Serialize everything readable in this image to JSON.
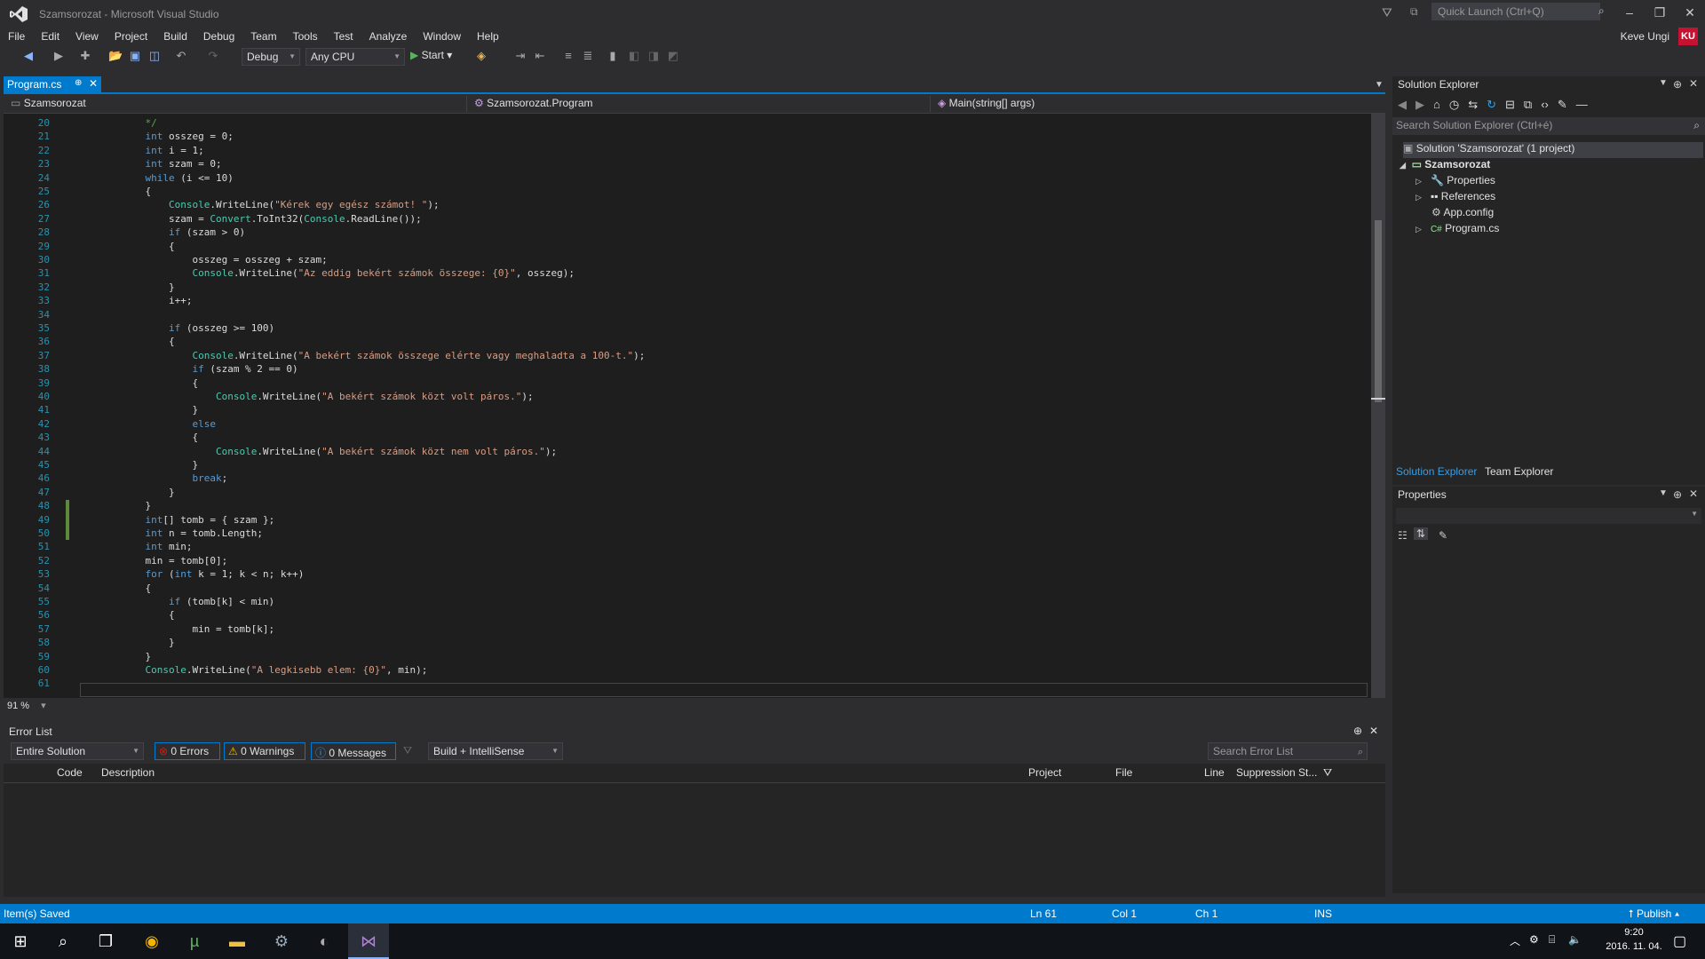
{
  "window": {
    "title": "Szamsorozat - Microsoft Visual Studio",
    "quick_launch_placeholder": "Quick Launch (Ctrl+Q)"
  },
  "menu": [
    "File",
    "Edit",
    "View",
    "Project",
    "Build",
    "Debug",
    "Team",
    "Tools",
    "Test",
    "Analyze",
    "Window",
    "Help"
  ],
  "user": {
    "name": "Keve Ungi",
    "initials": "KU"
  },
  "toolbar": {
    "config": "Debug",
    "platform": "Any CPU",
    "start_label": "Start"
  },
  "editor": {
    "tab_label": "Program.cs",
    "nav": {
      "project": "Szamsorozat",
      "class": "Szamsorozat.Program",
      "member": "Main(string[] args)"
    },
    "zoom": "91 %",
    "lines": [
      {
        "n": "20",
        "t": "            */"
      },
      {
        "n": "21",
        "t": "            int osszeg = 0;"
      },
      {
        "n": "22",
        "t": "            int i = 1;"
      },
      {
        "n": "23",
        "t": "            int szam = 0;"
      },
      {
        "n": "24",
        "t": "            while (i <= 10)"
      },
      {
        "n": "25",
        "t": "            {"
      },
      {
        "n": "26",
        "t": "                Console.WriteLine(\"Kérek egy egész számot! \");"
      },
      {
        "n": "27",
        "t": "                szam = Convert.ToInt32(Console.ReadLine());"
      },
      {
        "n": "28",
        "t": "                if (szam > 0)"
      },
      {
        "n": "29",
        "t": "                {"
      },
      {
        "n": "30",
        "t": "                    osszeg = osszeg + szam;"
      },
      {
        "n": "31",
        "t": "                    Console.WriteLine(\"Az eddig bekért számok összege: {0}\", osszeg);"
      },
      {
        "n": "32",
        "t": "                }"
      },
      {
        "n": "33",
        "t": "                i++;"
      },
      {
        "n": "34",
        "t": ""
      },
      {
        "n": "35",
        "t": "                if (osszeg >= 100)"
      },
      {
        "n": "36",
        "t": "                {"
      },
      {
        "n": "37",
        "t": "                    Console.WriteLine(\"A bekért számok összege elérte vagy meghaladta a 100-t.\");"
      },
      {
        "n": "38",
        "t": "                    if (szam % 2 == 0)"
      },
      {
        "n": "39",
        "t": "                    {"
      },
      {
        "n": "40",
        "t": "                        Console.WriteLine(\"A bekért számok közt volt páros.\");"
      },
      {
        "n": "41",
        "t": "                    }"
      },
      {
        "n": "42",
        "t": "                    else"
      },
      {
        "n": "43",
        "t": "                    {"
      },
      {
        "n": "44",
        "t": "                        Console.WriteLine(\"A bekért számok közt nem volt páros.\");"
      },
      {
        "n": "45",
        "t": "                    }"
      },
      {
        "n": "46",
        "t": "                    break;"
      },
      {
        "n": "47",
        "t": "                }"
      },
      {
        "n": "48",
        "t": "            }"
      },
      {
        "n": "49",
        "t": "            int[] tomb = { szam };"
      },
      {
        "n": "50",
        "t": "            int n = tomb.Length;"
      },
      {
        "n": "51",
        "t": "            int min;"
      },
      {
        "n": "52",
        "t": "            min = tomb[0];"
      },
      {
        "n": "53",
        "t": "            for (int k = 1; k < n; k++)"
      },
      {
        "n": "54",
        "t": "            {"
      },
      {
        "n": "55",
        "t": "                if (tomb[k] < min)"
      },
      {
        "n": "56",
        "t": "                {"
      },
      {
        "n": "57",
        "t": "                    min = tomb[k];"
      },
      {
        "n": "58",
        "t": "                }"
      },
      {
        "n": "59",
        "t": "            }"
      },
      {
        "n": "60",
        "t": "            Console.WriteLine(\"A legkisebb elem: {0}\", min);"
      },
      {
        "n": "61",
        "t": ""
      }
    ]
  },
  "error_list": {
    "title": "Error List",
    "scope": "Entire Solution",
    "errors": "0 Errors",
    "warnings": "0 Warnings",
    "messages": "0 Messages",
    "source": "Build + IntelliSense",
    "search_placeholder": "Search Error List",
    "columns": [
      "Code",
      "Description",
      "Project",
      "File",
      "Line",
      "Suppression St..."
    ]
  },
  "solution_explorer": {
    "title": "Solution Explorer",
    "search_placeholder": "Search Solution Explorer (Ctrl+é)",
    "solution": "Solution 'Szamsorozat' (1 project)",
    "project": "Szamsorozat",
    "items": [
      "Properties",
      "References",
      "App.config",
      "Program.cs"
    ],
    "tabs": [
      "Solution Explorer",
      "Team Explorer"
    ]
  },
  "properties": {
    "title": "Properties"
  },
  "status": {
    "message": "Item(s) Saved",
    "ln": "Ln 61",
    "col": "Col 1",
    "ch": "Ch 1",
    "ins": "INS",
    "publish": "Publish"
  },
  "taskbar": {
    "time": "9:20",
    "date": "2016. 11. 04."
  },
  "colors": {
    "accent": "#007acc",
    "editor_bg": "#1e1e1e",
    "keyword": "#569cd6",
    "type": "#4ec9b0",
    "string": "#d69d85"
  }
}
